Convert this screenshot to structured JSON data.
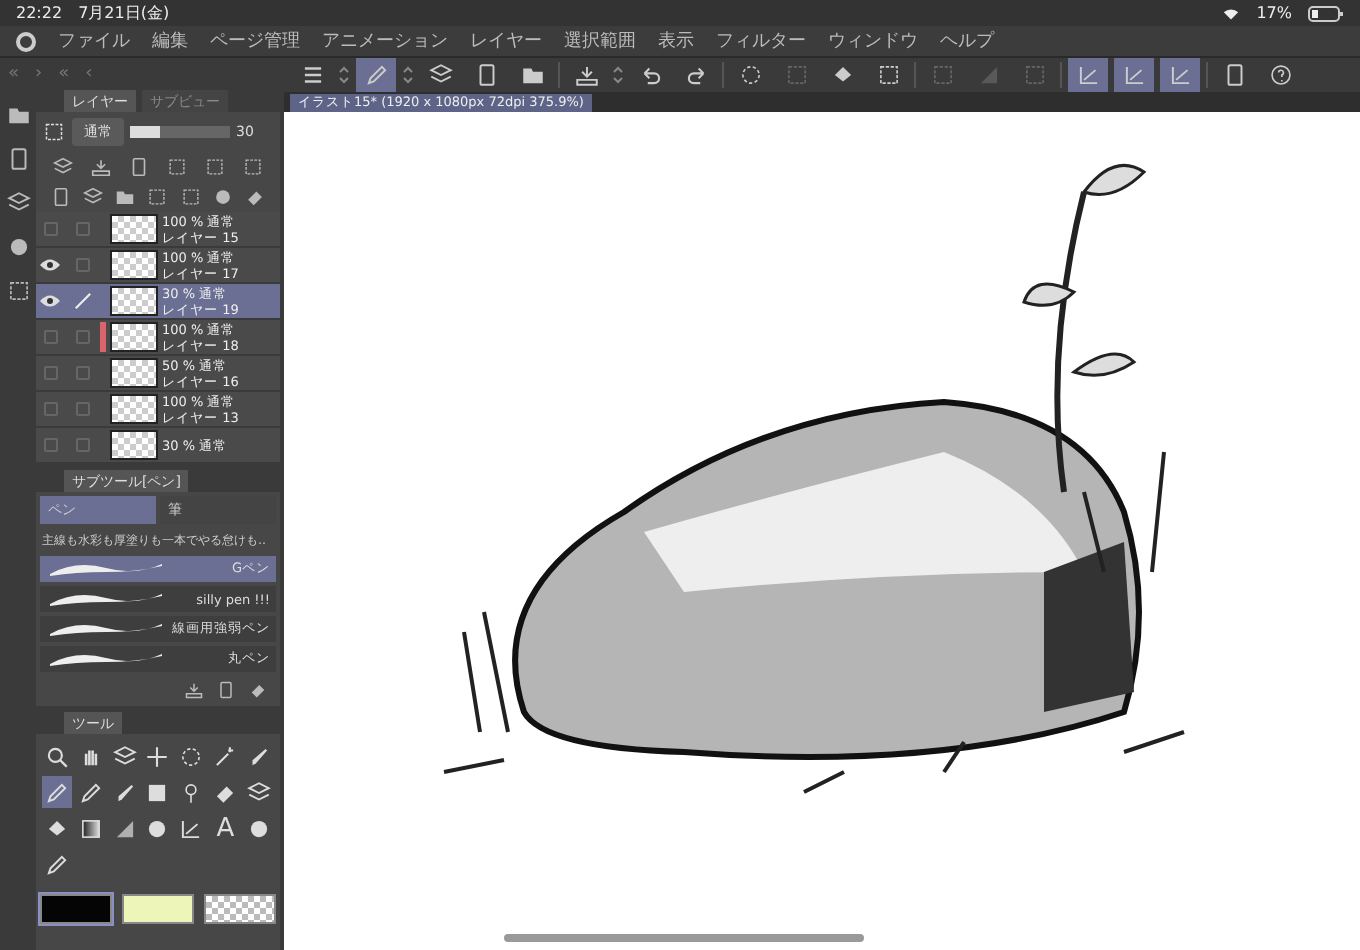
{
  "status_bar": {
    "time": "22:22",
    "date": "7月21日(金)",
    "battery": "17%"
  },
  "menu": [
    "ファイル",
    "編集",
    "ページ管理",
    "アニメーション",
    "レイヤー",
    "選択範囲",
    "表示",
    "フィルター",
    "ウィンドウ",
    "ヘルプ"
  ],
  "panel_nav": [
    "«",
    "›",
    "«",
    "‹"
  ],
  "toolbar": [
    {
      "selected": false,
      "disabled": false
    },
    {
      "selected": true,
      "disabled": false
    },
    {
      "selected": false,
      "disabled": false
    },
    {
      "selected": false,
      "disabled": false
    },
    {
      "selected": false,
      "disabled": false
    },
    {
      "selected": false,
      "disabled": false
    },
    {
      "selected": false,
      "disabled": false
    },
    {
      "selected": false,
      "disabled": false
    },
    {
      "selected": false,
      "disabled": false
    },
    {
      "selected": false,
      "disabled": true
    },
    {
      "selected": false,
      "disabled": false
    },
    {
      "selected": false,
      "disabled": false
    },
    {
      "selected": false,
      "disabled": true
    },
    {
      "selected": false,
      "disabled": true
    },
    {
      "selected": false,
      "disabled": true
    },
    {
      "selected": true,
      "disabled": false
    },
    {
      "selected": true,
      "disabled": false
    },
    {
      "selected": true,
      "disabled": false
    },
    {
      "selected": false,
      "disabled": false
    },
    {
      "selected": false,
      "disabled": false
    }
  ],
  "layer_panel": {
    "tabs": [
      {
        "label": "レイヤー",
        "selected": true
      },
      {
        "label": "サブビュー",
        "selected": false
      }
    ],
    "blend_mode": "通常",
    "opacity": {
      "level": 0.3,
      "value": "30"
    },
    "layers": [
      {
        "opacity_mode": "100 % 通常",
        "name": "レイヤー 15",
        "visible": false,
        "selected": false,
        "editing": false
      },
      {
        "opacity_mode": "100 % 通常",
        "name": "レイヤー 17",
        "visible": true,
        "selected": false,
        "editing": false
      },
      {
        "opacity_mode": "30 % 通常",
        "name": "レイヤー 19",
        "visible": true,
        "selected": true,
        "editing": true
      },
      {
        "opacity_mode": "100 % 通常",
        "name": "レイヤー 18",
        "visible": false,
        "selected": false,
        "editing": false,
        "color": "#d9646b"
      },
      {
        "opacity_mode": "50 % 通常",
        "name": "レイヤー 16",
        "visible": false,
        "selected": false,
        "editing": false
      },
      {
        "opacity_mode": "100 % 通常",
        "name": "レイヤー 13",
        "visible": false,
        "selected": false,
        "editing": false
      },
      {
        "opacity_mode": "30 % 通常",
        "visible": false,
        "selected": false,
        "editing": false
      }
    ]
  },
  "subtool_panel": {
    "title": "サブツール[ペン]",
    "groups": [
      {
        "label": "ペン",
        "selected": true
      },
      {
        "label": "筆",
        "selected": false
      }
    ],
    "description": "主線も水彩も厚塗りも一本でやる怠けも‥",
    "brushes": [
      {
        "name": "Gペン",
        "selected": true
      },
      {
        "name": "silly pen !!!",
        "selected": false
      },
      {
        "name": "線画用強弱ペン",
        "selected": false
      },
      {
        "name": "丸ペン",
        "selected": false
      }
    ]
  },
  "tool_panel": {
    "title": "ツール",
    "tools": [
      {
        "selected": false
      },
      {
        "selected": false
      },
      {
        "selected": false
      },
      {
        "selected": false
      },
      {
        "selected": false
      },
      {
        "selected": false
      },
      {
        "selected": false
      },
      {
        "selected": true
      },
      {
        "selected": false
      },
      {
        "selected": false
      },
      {
        "selected": false
      },
      {
        "selected": false
      },
      {
        "selected": false
      },
      {
        "selected": false
      },
      {
        "selected": false
      },
      {
        "selected": false
      },
      {
        "selected": false
      },
      {
        "selected": false
      },
      {
        "selected": false
      },
      {
        "selected": false,
        "glyph": "A"
      },
      {
        "selected": false
      },
      {
        "selected": false
      }
    ],
    "colors": [
      {
        "kind": "solid",
        "color": "#050505",
        "selected": true
      },
      {
        "kind": "solid",
        "color": "#eef5b8",
        "selected": false
      },
      {
        "kind": "transparent",
        "selected": false
      }
    ]
  },
  "canvas": {
    "tab": "イラスト15* (1920 x 1080px 72dpi 375.9%)"
  }
}
